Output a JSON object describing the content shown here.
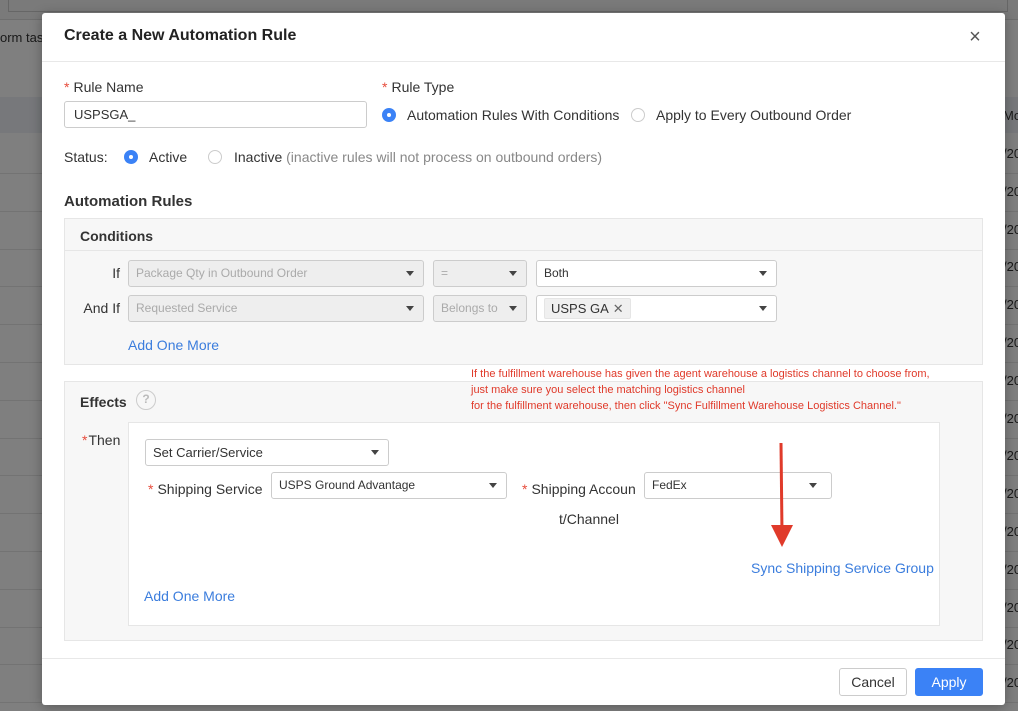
{
  "background": {
    "left_text": "orm tas",
    "right_header": "Mo",
    "right_cells": [
      "/20",
      "/20",
      "/20",
      "/20",
      "/20",
      "/20",
      "/20",
      "/20",
      "/20",
      "/20",
      "/20",
      "/20",
      "/20",
      "/20",
      "/20"
    ]
  },
  "modal": {
    "title": "Create a New Automation Rule",
    "close_icon": "close-icon"
  },
  "form": {
    "rule_name_label": "Rule Name",
    "rule_name_value": "USPSGA_",
    "rule_type_label": "Rule Type",
    "rule_type_options": [
      {
        "label": "Automation Rules With Conditions",
        "selected": true
      },
      {
        "label": "Apply to Every Outbound Order",
        "selected": false
      }
    ],
    "status_label": "Status:",
    "status_options": [
      {
        "label": "Active",
        "selected": true
      },
      {
        "label": "Inactive",
        "selected": false
      }
    ],
    "inactive_hint": "(inactive rules will not process on outbound orders)"
  },
  "automation_rules": {
    "title": "Automation Rules",
    "conditions": {
      "title": "Conditions",
      "rows": [
        {
          "prefix": "If",
          "field": "Package Qty in Outbound Order",
          "operator": "=",
          "value": "Both"
        },
        {
          "prefix": "And If",
          "field": "Requested Service",
          "operator": "Belongs to",
          "value_tag": "USPS GA"
        }
      ],
      "add_more": "Add One More"
    },
    "effects": {
      "title": "Effects",
      "help_icon": "question-circle-icon",
      "then_label": "Then",
      "action": "Set Carrier/Service",
      "shipping_service_label": "Shipping Service",
      "shipping_service_value": "USPS Ground Advantage",
      "shipping_account_label_1": "Shipping Accoun",
      "shipping_account_label_2": "t/Channel",
      "shipping_account_value": "FedEx",
      "sync_link": "Sync Shipping Service Group",
      "add_more": "Add One More"
    }
  },
  "annotation": {
    "lines": [
      "If the fulfillment warehouse has given the agent warehouse a logistics channel to choose from,",
      " just make sure you select the matching logistics channel",
      "for the fulfillment warehouse, then click   \"Sync Fulfillment Warehouse Logistics Channel.\""
    ],
    "color": "#e03a2a"
  },
  "footer": {
    "cancel": "Cancel",
    "apply": "Apply"
  },
  "colors": {
    "primary": "#3b82f6",
    "link": "#3b7ddd",
    "required": "#e74c3c"
  }
}
